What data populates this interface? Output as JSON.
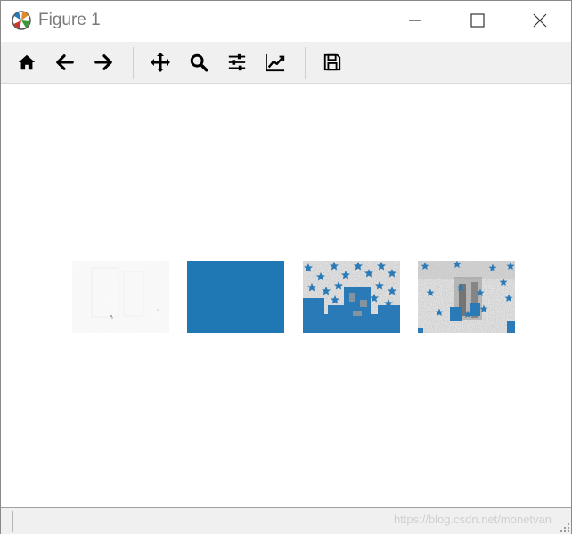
{
  "window": {
    "title": "Figure 1",
    "app_icon": "matplotlib-logo-icon"
  },
  "toolbar": {
    "buttons": [
      {
        "name": "home",
        "icon": "home-icon"
      },
      {
        "name": "back",
        "icon": "arrow-left-icon"
      },
      {
        "name": "forward",
        "icon": "arrow-right-icon"
      },
      {
        "name": "pan",
        "icon": "move-icon"
      },
      {
        "name": "zoom",
        "icon": "magnifier-icon"
      },
      {
        "name": "configure-subplots",
        "icon": "sliders-icon"
      },
      {
        "name": "edit-axis",
        "icon": "line-chart-icon"
      },
      {
        "name": "save",
        "icon": "floppy-disk-icon"
      }
    ]
  },
  "figure": {
    "subplot_count": 4,
    "mask_color": "#2a7ab8",
    "panels": [
      {
        "name": "nearly-white-image",
        "description_color": "#f8f8f8"
      },
      {
        "name": "solid-blue-image",
        "description_color": "#1f77b4"
      },
      {
        "name": "noise-with-blue-stars-image",
        "description_color": "#b0b0b0"
      },
      {
        "name": "grey-scene-with-blue-stars-image",
        "description_color": "#a0a0a0"
      }
    ]
  },
  "statusbar": {
    "watermark": "https://blog.csdn.net/monetvan"
  }
}
